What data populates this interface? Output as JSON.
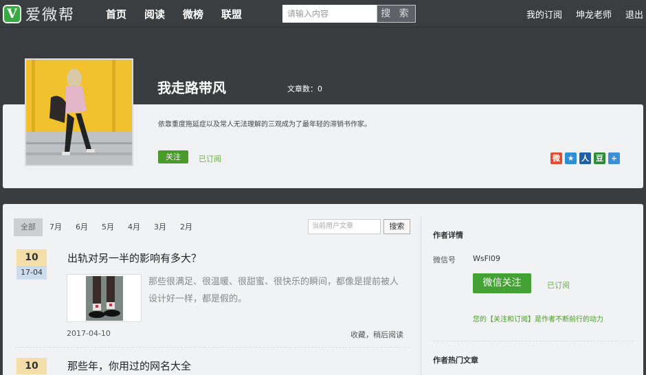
{
  "header": {
    "logo_mark": "V",
    "logo_text": "爱微帮",
    "nav": [
      "首页",
      "阅读",
      "微榜",
      "联盟"
    ],
    "search_placeholder": "请输入内容",
    "search_button": "搜 索",
    "right_links": [
      "我的订阅",
      "坤龙老师",
      "退出"
    ]
  },
  "profile": {
    "name": "我走路带风",
    "article_count": "文章数：0",
    "bio": "依靠重度拖延症以及常人无法理解的三观成为了最年轻的滞销书作家。",
    "follow_label": "关注",
    "subscribed_label": "已订阅",
    "share_icons": [
      {
        "icon": "weibo-icon",
        "glyph": "微",
        "color": "#e64a2e"
      },
      {
        "icon": "qzone-icon",
        "glyph": "★",
        "color": "#2c8fd6"
      },
      {
        "icon": "renren-icon",
        "glyph": "人",
        "color": "#1f5fa8"
      },
      {
        "icon": "douban-icon",
        "glyph": "豆",
        "color": "#2e8b3a"
      },
      {
        "icon": "more-share-icon",
        "glyph": "+",
        "color": "#3c8ed8"
      }
    ]
  },
  "filters": {
    "tabs": [
      "全部",
      "7月",
      "6月",
      "5月",
      "4月",
      "3月",
      "2月"
    ],
    "active_tab": "全部",
    "search_placeholder": "当前用户文章",
    "search_button": "搜索"
  },
  "articles": [
    {
      "day": "10",
      "month_day": "17-04",
      "title": "出轨对另一半的影响有多大？",
      "summary": "那些很满足、很温暖、很甜蜜、很快乐的瞬间，都像是提前被人设计好一样，都是假的。",
      "date": "2017-04-10",
      "actions": "收藏，稍后阅读"
    },
    {
      "day": "10",
      "title": "那些年，你用过的网名大全"
    }
  ],
  "sidebar": {
    "details_title": "作者详情",
    "wechat_label": "微信号",
    "wechat_id": "WsFl09",
    "follow_button": "微信关注",
    "subscribed": "已订阅",
    "tip": "您的【关注和订阅】是作者不断前行的动力",
    "hot_title": "作者热门文章"
  }
}
